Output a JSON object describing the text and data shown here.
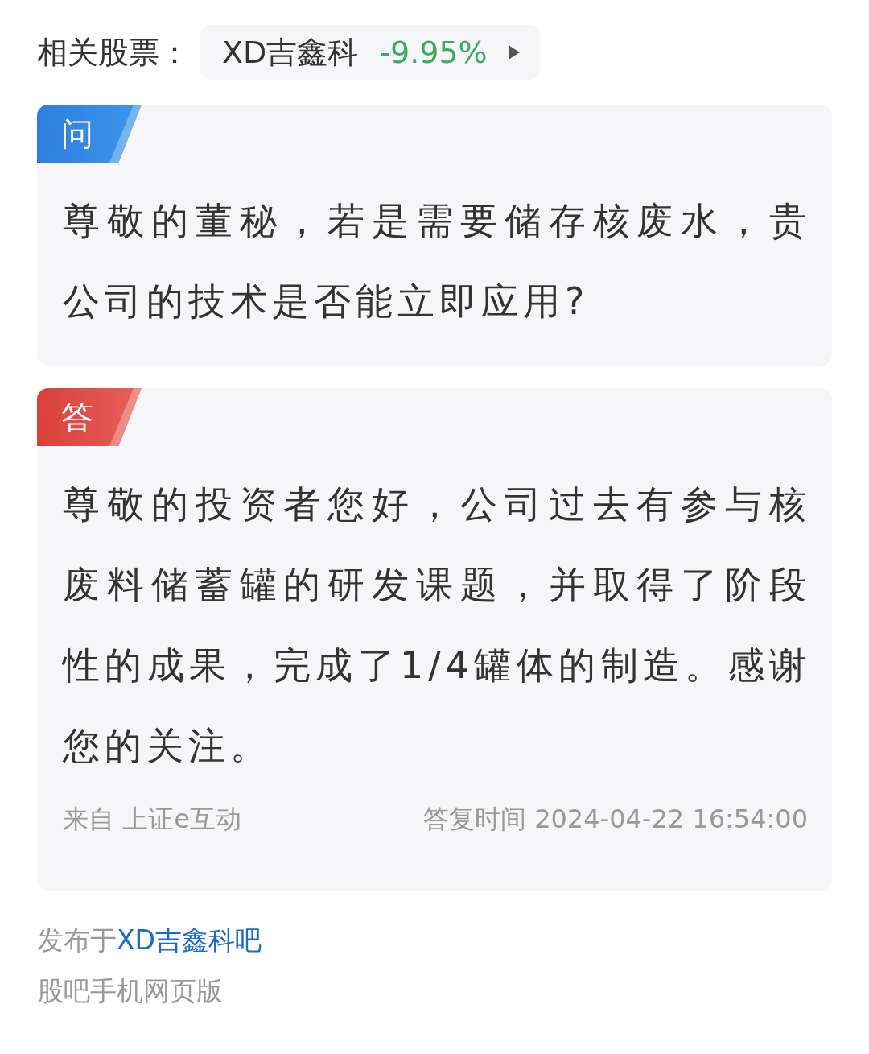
{
  "related_stock": {
    "label": "相关股票：",
    "name": "XD吉鑫科",
    "change": "-9.95%",
    "color": "#3cab5f"
  },
  "cards": [
    {
      "kind": "question",
      "badge": "问",
      "text": "尊敬的董秘，若是需要储存核废水，贵公司的技术是否能立即应用?"
    },
    {
      "kind": "answer",
      "badge": "答",
      "text": "尊敬的投资者您好，公司过去有参与核废料储蓄罐的研发课题，并取得了阶段性的成果，完成了1/4罐体的制造。感谢您的关注。",
      "source": "来自 上证e互动",
      "time": "答复时间 2024-04-22 16:54:00"
    }
  ],
  "footer": {
    "posted_prefix": "发布于",
    "forum_link": "XD吉鑫科吧",
    "version": "股吧手机网页版"
  }
}
